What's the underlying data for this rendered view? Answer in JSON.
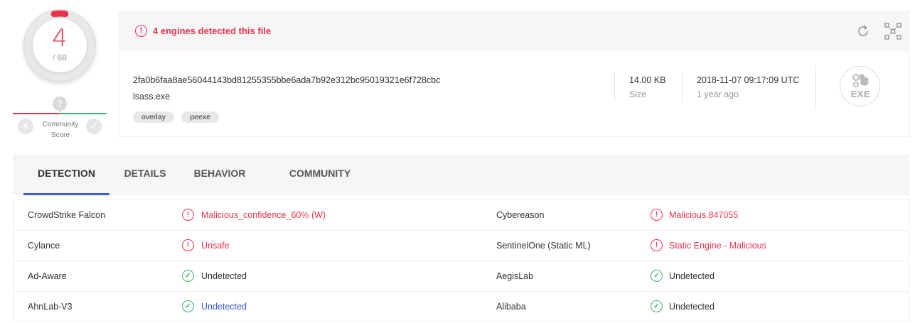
{
  "score": {
    "detected": "4",
    "total": "/ 68"
  },
  "community": {
    "pin_symbol": "?",
    "label_line1": "Community",
    "label_line2": "Score",
    "vote_down_symbol": "✕",
    "vote_up_symbol": "✓"
  },
  "alert": {
    "text": "4 engines detected this file",
    "icon_symbol": "!"
  },
  "file": {
    "hash": "2fa0b6faa8ae56044143bd81255355bbe6ada7b92e312bc95019321e6f728cbc",
    "name": "lsass.exe",
    "tags": [
      "overlay",
      "peexe"
    ],
    "size_value": "14.00 KB",
    "size_label": "Size",
    "date_value": "2018-11-07 09:17:09 UTC",
    "date_label": "1 year ago",
    "type_badge": "EXE"
  },
  "tabs": [
    "DETECTION",
    "DETAILS",
    "BEHAVIOR",
    "COMMUNITY"
  ],
  "detections": [
    {
      "engine_left": "CrowdStrike Falcon",
      "result_left": "Malicious_confidence_60% (W)",
      "status_left": "malicious",
      "engine_right": "Cybereason",
      "result_right": "Malicious.847055",
      "status_right": "malicious"
    },
    {
      "engine_left": "Cylance",
      "result_left": "Unsafe",
      "status_left": "malicious",
      "engine_right": "SentinelOne (Static ML)",
      "result_right": "Static Engine - Malicious",
      "status_right": "malicious"
    },
    {
      "engine_left": "Ad-Aware",
      "result_left": "Undetected",
      "status_left": "clean",
      "engine_right": "AegisLab",
      "result_right": "Undetected",
      "status_right": "clean"
    },
    {
      "engine_left": "AhnLab-V3",
      "result_left": "Undetected",
      "status_left": "clean-link",
      "engine_right": "Alibaba",
      "result_right": "Undetected",
      "status_right": "clean"
    }
  ],
  "colors": {
    "malicious": "#e8334e",
    "clean": "#3cb371",
    "accent": "#3b5bdb"
  }
}
